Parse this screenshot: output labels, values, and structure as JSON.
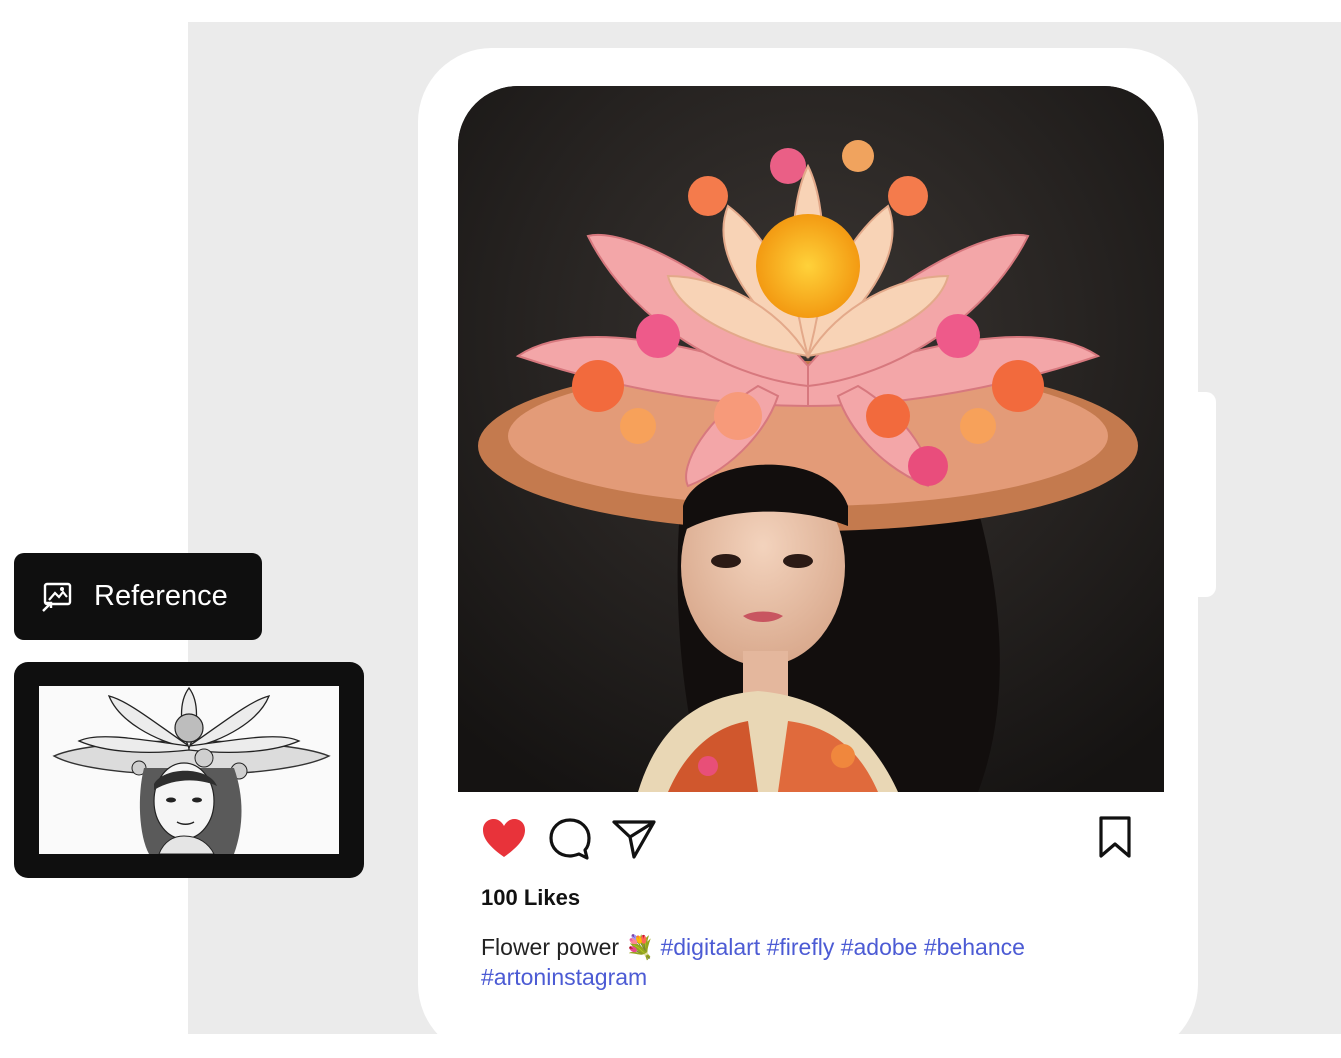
{
  "reference": {
    "label": "Reference",
    "icon": "image-reference-icon"
  },
  "post": {
    "likes": "100 Likes",
    "caption_text": "Flower power",
    "caption_emoji": "💐",
    "hashtags": "#digitalart #firefly #adobe #behance #artoninstagram",
    "icons": {
      "like": "heart-icon",
      "comment": "comment-icon",
      "share": "send-icon",
      "save": "bookmark-icon"
    },
    "colors": {
      "heart": "#e8333a",
      "hashtag": "#4c5bd4"
    }
  }
}
